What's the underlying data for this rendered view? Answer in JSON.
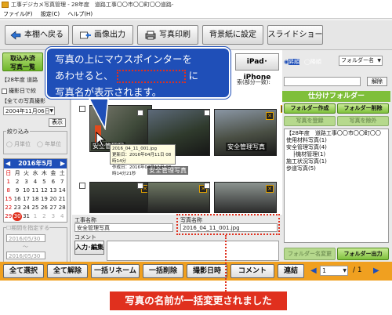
{
  "window": {
    "title": "工事デジカメ写真管理 - 28年度　道路工事〇〇市〇〇町〇〇道路-"
  },
  "menu": {
    "file": "ファイル(F)",
    "settings": "設定(C)",
    "help": "ヘルプ(H)"
  },
  "toolbar": {
    "back": "本棚へ戻る",
    "image_output": "画像出力",
    "photo_print": "写真印刷",
    "set_wallpaper": "背景紙に設定",
    "slideshow": "スライドショー",
    "ipad": "iPad･iPhone"
  },
  "left": {
    "import_btn": "取込み済\n写真一覧",
    "project_prefix": "【28年度 道路",
    "shooting_date_check": "撮影日で絞",
    "all_photos_label": "【全ての写真撮影",
    "date_value": "2004年11月06日",
    "show_btn": "表示",
    "filter_label": "絞り込み",
    "by_month": "月単位",
    "by_year": "年単位",
    "calendar_month": "2016年5月",
    "weekdays": [
      "日",
      "月",
      "火",
      "水",
      "木",
      "金",
      "土"
    ],
    "weeks": [
      [
        "1",
        "2",
        "3",
        "4",
        "5",
        "6",
        "7"
      ],
      [
        "8",
        "9",
        "10",
        "11",
        "12",
        "13",
        "14"
      ],
      [
        "15",
        "16",
        "17",
        "18",
        "19",
        "20",
        "21"
      ],
      [
        "22",
        "23",
        "24",
        "25",
        "26",
        "27",
        "28"
      ],
      [
        "29",
        "30",
        "31",
        "1",
        "2",
        "3",
        "4"
      ]
    ],
    "period_label": "期間を指定する",
    "period_from": "2016/05/30",
    "period_sep": "〜",
    "period_to": "2016/05/30"
  },
  "photos": {
    "tooltip_name": "2016_04_11_001.jpg",
    "tooltip_updated": "更新日：2016年04月11日 08時14分",
    "tooltip_created": "作成日：2016年04月11日 08時14分21秒",
    "caption_1": "安全管理写",
    "caption_2": "安全管理写真",
    "caption_3": "安全管理写真"
  },
  "details": {
    "work_name_label": "工事名称",
    "work_name_value": "安全管理写真",
    "photo_name_label": "写真名称",
    "photo_name_value": "2016_04_11_001.jpg",
    "comment_label": "コメント",
    "input_edit_btn": "入力･編集"
  },
  "right": {
    "radio_ascending": "昇順",
    "radio_descending": "降順",
    "sort_select": "フォルダー名",
    "search_label": "索(部分一致):",
    "cancel_btn": "解除",
    "folder_header": "仕分けフォルダー",
    "create_folder": "フォルダー作成",
    "delete_folder": "フォルダー削除",
    "register_photo": "写真を登録",
    "remove_photo": "写真を除外",
    "tree": [
      "【28年度　道路工事〇〇市〇〇町〇〇",
      "使用材料写真(1)",
      "安全管理写真(4)",
      "├機材管理(1)",
      "施工状況写真(1)",
      "歩道写真(5)"
    ],
    "rename_folder": "フォルダー名変更",
    "folder_output": "フォルダー出力"
  },
  "bottom": {
    "select_all": "全て選択",
    "deselect_all": "全て解除",
    "bulk_rename": "一括リネーム",
    "bulk_delete": "一括削除",
    "shooting_datetime": "撮影日時",
    "comment": "コメント",
    "link": "連結",
    "page_current": "1",
    "page_total": "/ 1"
  },
  "callout": {
    "line1": "写真の上にマウスポインターを",
    "line2_pre": "あわせると、",
    "line2_post": "に",
    "line3": "写真名が表示されます。"
  },
  "banner": {
    "text": "写真の名前が一括変更されました"
  },
  "colors": {
    "orange": "#f0a020",
    "green": "#7fbf3a",
    "callout_blue": "#1f4fb8",
    "banner_red": "#e0301e",
    "marker_red": "#e0301e"
  }
}
